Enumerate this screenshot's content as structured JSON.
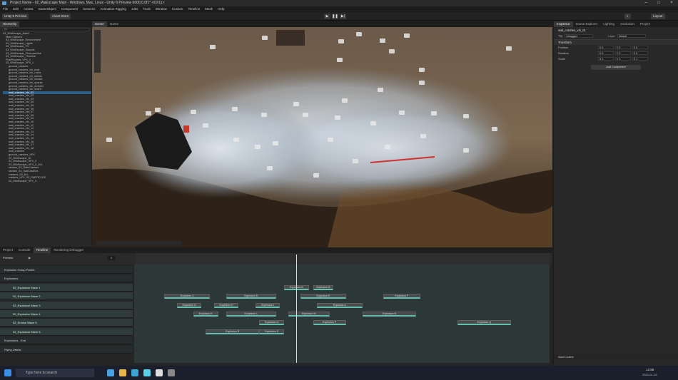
{
  "window": {
    "title": "Project Name - 02_WaEscape Main - Windows, Mac, Linux - Unity 6 Preview 6000.0.0f1* <DX11>"
  },
  "menu": [
    "File",
    "Edit",
    "Assets",
    "GameObject",
    "Component",
    "Services",
    "Animation Rigging",
    "Jobs",
    "Tools",
    "Window",
    "Custom",
    "Timeline",
    "Mesh",
    "Help"
  ],
  "toolbar": {
    "account": "Unity 6 Preview",
    "asset_store": "Asset Store",
    "layout": "Layout"
  },
  "hierarchy": {
    "tab": "Hierarchy",
    "search_placeholder": "All",
    "rows": [
      "03_WinEscape_Main*",
      "Main Camera",
      "03_WinEscape_Environment",
      "03_WinEscape_Lights",
      "03_WinEscape_FX",
      "03_WinEscape_Sounds",
      "03_WinEscape_Cinemachine",
      "03_WinEscape_Timeline",
      "PostProcess_VFX_1",
      "03_WinEscape_VFX_1",
      "ground_crashes",
      "ground_crashes_vfx_dust",
      "ground_crashes_vfx_rocks",
      "ground_crashes_vfx_debris",
      "ground_crashes_vfx_smoke",
      "ground_crashes_vfx_sparks",
      "ground_crashes_vfx_embers",
      "ground_crashes_vfx_shard",
      "wall_crashes_vfx_01",
      "wall_crashes_vfx_02",
      "wall_crashes_vfx_03",
      "wall_crashes_vfx_04",
      "wall_crashes_vfx_05",
      "wall_crashes_vfx_06",
      "wall_crashes_vfx_07",
      "wall_crashes_vfx_08",
      "wall_crashes_vfx_09",
      "wall_crashes_vfx_10",
      "wall_crashes_vfx_11",
      "wall_crashes_vfx_12",
      "wall_crashes_vfx_13",
      "wall_crashes_vfx_14",
      "wall_crashes_vfx_15",
      "wall_crashes_vfx_16",
      "wall_crashes_vfx_17",
      "wall_crashes_vfx_18",
      "wall_crashes",
      "ground_crashes_VFX",
      "03_WinEscape_UI",
      "03_WinEscape_VFX_2",
      "03_WinEscape_VFX_2_ALL",
      "section_03_SideCrashes",
      "section_03_SubCrashes",
      "crashes_03_ALL",
      "crashes_VFX_03_PARTICLES",
      "03_WinEscape_VFX_3"
    ],
    "selected_index": 18
  },
  "scene": {
    "tab_scene": "Scene",
    "tab_game": "Game",
    "shading": "Shaded",
    "mode": "2D"
  },
  "inspector": {
    "tabs": [
      "Inspector",
      "Scene Explorer",
      "Lighting",
      "Occlusion",
      "Project"
    ],
    "object_name": "wall_crashes_vfx_01",
    "tag_label": "Tag",
    "tag_value": "Untagged",
    "layer_label": "Layer",
    "layer_value": "Default",
    "component": "Transform",
    "rows": [
      {
        "label": "Position",
        "x": "0",
        "y": "0",
        "z": "0"
      },
      {
        "label": "Rotation",
        "x": "0",
        "y": "0",
        "z": "0"
      },
      {
        "label": "Scale",
        "x": "1",
        "y": "1",
        "z": "1"
      }
    ],
    "add_component": "Add Component",
    "asset_labels": "Asset Labels"
  },
  "bottom_tabs": [
    "Project",
    "Console",
    "Timeline",
    "Rendering Debugger"
  ],
  "timeline": {
    "frame": "0",
    "preview": "Preview",
    "tracks": [
      {
        "name": "Explosion Group Parent",
        "group": true
      },
      {
        "name": "Explosions",
        "group": true
      },
      {
        "name": "02_Explosion Wave 1",
        "group": false
      },
      {
        "name": "02_Explosion Wave 2",
        "group": false
      },
      {
        "name": "02_Explosion Wave 3",
        "group": false
      },
      {
        "name": "02_Explosion Wave 4",
        "group": false
      },
      {
        "name": "02_Smoke Wave 5",
        "group": false
      },
      {
        "name": "02_Explosion Wave 6",
        "group": false
      },
      {
        "name": "Explosions - End",
        "group": true
      },
      {
        "name": "Flying Debris",
        "group": true
      }
    ],
    "clips": [
      {
        "label": "Explosion A",
        "track": 2,
        "start": 0.36,
        "dur": 0.06
      },
      {
        "label": "Explosion B",
        "track": 2,
        "start": 0.43,
        "dur": 0.05
      },
      {
        "label": "Explosion C",
        "track": 3,
        "start": 0.07,
        "dur": 0.11
      },
      {
        "label": "Explosion D",
        "track": 3,
        "start": 0.22,
        "dur": 0.12
      },
      {
        "label": "Explosion E",
        "track": 3,
        "start": 0.4,
        "dur": 0.11
      },
      {
        "label": "Explosion F",
        "track": 3,
        "start": 0.6,
        "dur": 0.09
      },
      {
        "label": "Explosion G",
        "track": 4,
        "start": 0.1,
        "dur": 0.06
      },
      {
        "label": "Explosion H",
        "track": 4,
        "start": 0.19,
        "dur": 0.06
      },
      {
        "label": "Explosion I",
        "track": 4,
        "start": 0.29,
        "dur": 0.06
      },
      {
        "label": "Explosion J",
        "track": 4,
        "start": 0.44,
        "dur": 0.11
      },
      {
        "label": "Explosion K",
        "track": 5,
        "start": 0.14,
        "dur": 0.06
      },
      {
        "label": "Explosion L",
        "track": 5,
        "start": 0.22,
        "dur": 0.12
      },
      {
        "label": "Explosion M",
        "track": 5,
        "start": 0.37,
        "dur": 0.1
      },
      {
        "label": "Explosion N",
        "track": 5,
        "start": 0.55,
        "dur": 0.13
      },
      {
        "label": "Explosion O",
        "track": 6,
        "start": 0.3,
        "dur": 0.06
      },
      {
        "label": "Explosion P",
        "track": 6,
        "start": 0.43,
        "dur": 0.08
      },
      {
        "label": "Explosion Q",
        "track": 6,
        "start": 0.78,
        "dur": 0.13
      },
      {
        "label": "Explosion R",
        "track": 7,
        "start": 0.17,
        "dur": 0.13
      },
      {
        "label": "Explosion S",
        "track": 7,
        "start": 0.3,
        "dur": 0.06
      }
    ],
    "playhead": 0.39,
    "accent": "#5fbfb0"
  },
  "taskbar": {
    "search_placeholder": "Type here to search",
    "time": "12:56",
    "date": "2024-01-15"
  },
  "colors": {
    "selection": "#2c5d87",
    "accent": "#5fbfb0"
  }
}
